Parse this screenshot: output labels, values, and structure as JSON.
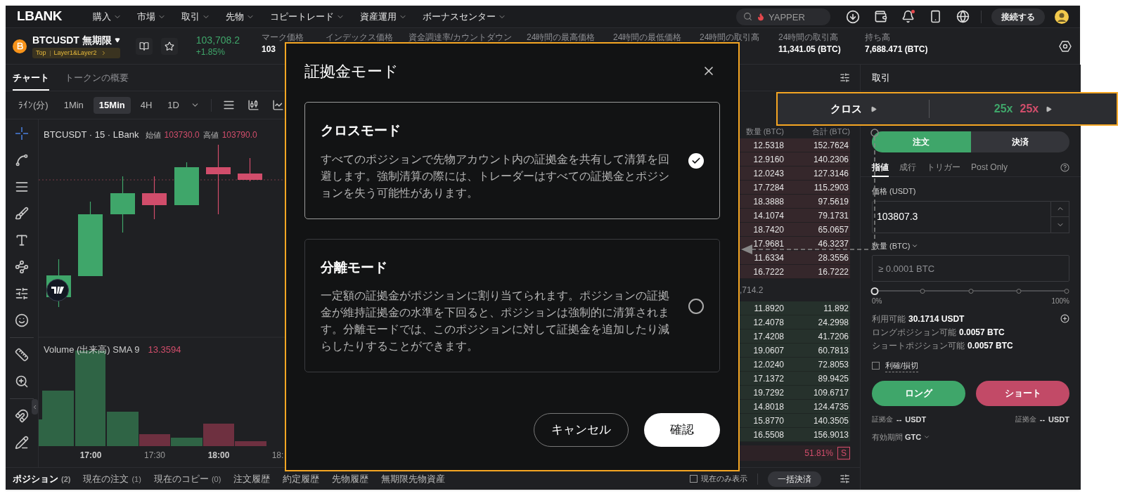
{
  "nav": {
    "logo": "LBANK",
    "menu": [
      {
        "label": "購入"
      },
      {
        "label": "市場"
      },
      {
        "label": "取引"
      },
      {
        "label": "先物"
      },
      {
        "label": "コピートレード"
      },
      {
        "label": "資産運用"
      },
      {
        "label": "ボーナスセンター"
      }
    ],
    "search": {
      "placeholder": "YAPPER"
    },
    "notification_dot": true,
    "connect_button": "接続する"
  },
  "ticker": {
    "symbol": "BTCUSDT 無期限",
    "tags": [
      "Top",
      "Layer1&Layer2"
    ],
    "price": "103,708.2",
    "change": "+1.85%",
    "stats": [
      {
        "label": "マーク価格",
        "value": "103"
      },
      {
        "label": "インデックス価格"
      },
      {
        "label": "資金調達率/カウントダウン"
      },
      {
        "label": "24時間の最高価格"
      },
      {
        "label": "24時間の最低価格"
      },
      {
        "label": "24時間の取引高"
      },
      {
        "label": "24時間の取引高",
        "value": "11,341.05 (BTC)"
      },
      {
        "label": "持ち高",
        "value": "7,688.471 (BTC)"
      }
    ]
  },
  "chart": {
    "tabs": [
      {
        "label": "チャート",
        "selected": true
      },
      {
        "label": "トークンの概要",
        "selected": false
      }
    ],
    "intervals": [
      {
        "label": "ﾗｲﾝ(分)",
        "selected": false
      },
      {
        "label": "1Min",
        "selected": false
      },
      {
        "label": "15Min",
        "selected": true
      },
      {
        "label": "4H",
        "selected": false
      },
      {
        "label": "1D",
        "selected": false
      }
    ],
    "legend": {
      "title": "BTCUSDT · 15 · LBank",
      "open_label": "始値",
      "open": "103730.0",
      "high_label": "高値",
      "high": "103790.0"
    },
    "volume_legend": {
      "title": "Volume (出来高) SMA 9",
      "value": "13.3594"
    },
    "time_labels": [
      "17:00",
      "17:30",
      "18:00",
      "18:"
    ]
  },
  "order_book": {
    "columns": [
      "数量 (BTC)",
      "合計 (BTC)"
    ],
    "asks": [
      {
        "qty": "12.5318",
        "total": "152.7624"
      },
      {
        "qty": "12.9160",
        "total": "140.2306"
      },
      {
        "qty": "12.0243",
        "total": "127.3146"
      },
      {
        "qty": "17.7284",
        "total": "115.2903"
      },
      {
        "qty": "18.3888",
        "total": "97.5619"
      },
      {
        "qty": "14.1074",
        "total": "79.1731"
      },
      {
        "qty": "18.7420",
        "total": "65.0657"
      },
      {
        "qty": "17.9681",
        "total": "46.3237"
      },
      {
        "qty": "11.6334",
        "total": "28.3556"
      },
      {
        "qty": "16.7222",
        "total": "16.7222"
      }
    ],
    "mid_price": ",714.2",
    "bids": [
      {
        "qty": "11.8920",
        "total": "11.892"
      },
      {
        "qty": "12.4078",
        "total": "24.2998"
      },
      {
        "qty": "17.4208",
        "total": "41.7206"
      },
      {
        "qty": "19.0607",
        "total": "60.7813"
      },
      {
        "qty": "12.0240",
        "total": "72.8053"
      },
      {
        "qty": "17.1372",
        "total": "89.9425"
      },
      {
        "qty": "19.7292",
        "total": "109.6717"
      },
      {
        "qty": "14.8018",
        "total": "124.4735"
      },
      {
        "qty": "15.8770",
        "total": "140.3505"
      },
      {
        "qty": "16.5508",
        "total": "156.9013"
      }
    ],
    "ratio": {
      "value": "51.81%",
      "side": "S"
    }
  },
  "trade": {
    "title": "取引",
    "margin_mode": "クロス",
    "leverage_long": "25x",
    "leverage_short": "25x",
    "sides": [
      {
        "label": "注文",
        "selected": true
      },
      {
        "label": "決済",
        "selected": false
      }
    ],
    "order_types": [
      {
        "label": "指値",
        "selected": true
      },
      {
        "label": "成行",
        "selected": false
      },
      {
        "label": "トリガー",
        "selected": false
      },
      {
        "label": "Post Only",
        "selected": false
      }
    ],
    "price": {
      "label": "価格 (USDT)",
      "value": "103807.3"
    },
    "quantity": {
      "label": "数量 (BTC)",
      "placeholder": "≥ 0.0001 BTC"
    },
    "slider": {
      "level": 0,
      "min_label": "0%",
      "max_label": "100%"
    },
    "info": [
      {
        "label": "利用可能",
        "value": "30.1714 USDT"
      },
      {
        "label": "ロングポジション可能",
        "value": "0.0057 BTC"
      },
      {
        "label": "ショートポジション可能",
        "value": "0.0057 BTC"
      }
    ],
    "tp_sl": {
      "label": "利確/損切",
      "checked": false
    },
    "long_button": "ロング",
    "short_button": "ショート",
    "margins": [
      {
        "label": "証拠金",
        "value": "--",
        "unit": "USDT"
      },
      {
        "label": "証拠金",
        "value": "--",
        "unit": "USDT"
      }
    ],
    "time_in_force": {
      "label": "有効期間",
      "value": "GTC"
    }
  },
  "bottom": {
    "tabs": [
      {
        "label": "ポジション",
        "count": "(2)",
        "selected": true
      },
      {
        "label": "現在の注文",
        "count": "(1)",
        "selected": false
      },
      {
        "label": "現在のコピー",
        "count": "(0)",
        "selected": false
      },
      {
        "label": "注文履歴",
        "selected": false
      },
      {
        "label": "約定履歴",
        "selected": false
      },
      {
        "label": "先物履歴",
        "selected": false
      },
      {
        "label": "無期限先物資産",
        "selected": false
      }
    ],
    "only_current": {
      "label": "現在のみ表示",
      "checked": false
    },
    "close_all": "一括決済"
  },
  "modal": {
    "title": "証拠金モード",
    "options": [
      {
        "title": "クロスモード",
        "description": "すべてのポジションで先物アカウント内の証拠金を共有して清算を回避します。強制清算の際には、トレーダーはすべての証拠金とポジションを失う可能性があります。",
        "selected": true
      },
      {
        "title": "分離モード",
        "description": "一定額の証拠金がポジションに割り当てられます。ポジションの証拠金が維持証拠金の水準を下回ると、ポジションは強制的に清算されます。分離モードでは、このポジションに対して証拠金を追加したり減らしたりすることができます。",
        "selected": false
      }
    ],
    "cancel": "キャンセル",
    "confirm": "確認"
  }
}
